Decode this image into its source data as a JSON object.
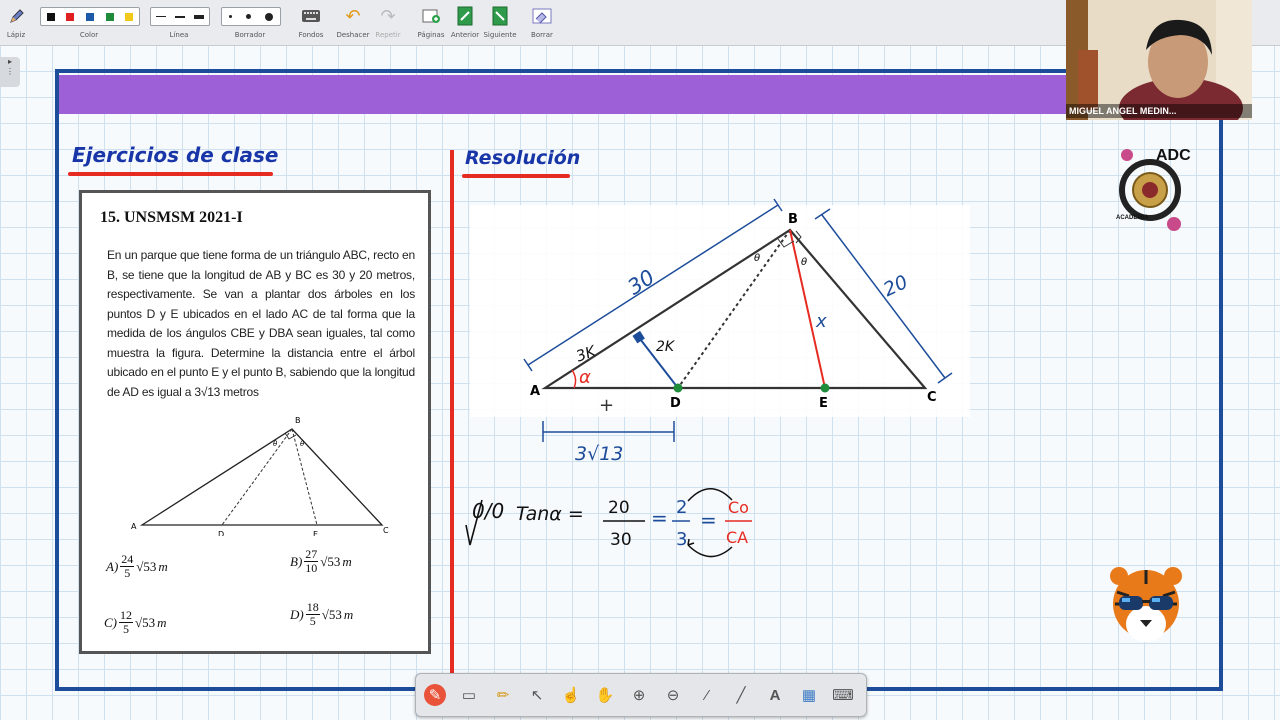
{
  "toolbar": {
    "items": [
      {
        "label": "Lápiz",
        "icon": "pencil-icon"
      },
      {
        "label": "Color"
      },
      {
        "label": "Línea"
      },
      {
        "label": "Borrador"
      },
      {
        "label": "Fondos",
        "icon": "keyboard-icon"
      },
      {
        "label": "Deshacer",
        "icon": "undo-icon"
      },
      {
        "label": "Repetir",
        "icon": "redo-icon"
      },
      {
        "label": "Páginas",
        "icon": "pages-icon"
      },
      {
        "label": "Anterior",
        "icon": "previous-page-icon"
      },
      {
        "label": "Siguiente",
        "icon": "next-page-icon"
      },
      {
        "label": "Borrar",
        "icon": "clear-icon"
      }
    ],
    "colors": [
      "#111111",
      "#e02020",
      "#1f5aa8",
      "#1e8c3a",
      "#f2c81a"
    ]
  },
  "webcam": {
    "name": "MIGUEL ANGEL MEDIN..."
  },
  "headings": {
    "left": "Ejercicios de clase",
    "right": "Resolución"
  },
  "problem": {
    "title": "15. UNSMSM 2021-I",
    "text": "En un parque que tiene forma de un triángulo ABC, recto en B, se tiene que la longitud de AB y BC es 30 y 20 metros, respectivamente. Se van a plantar dos árboles en los puntos D y E ubicados en el lado AC de tal forma que la medida de los ángulos CBE y DBA sean iguales, tal como muestra la figura. Determine la distancia entre el árbol ubicado en el punto E y el punto B, sabiendo que la longitud de AD es igual a 3",
    "text_root": "√13",
    "text_end": " metros",
    "figure_labels": {
      "A": "A",
      "B": "B",
      "C": "C",
      "D": "D",
      "E": "E",
      "theta": "θ"
    },
    "options": [
      {
        "letter": "A)",
        "num": "24",
        "den": "5",
        "root": "√53",
        "unit": "m"
      },
      {
        "letter": "B)",
        "num": "27",
        "den": "10",
        "root": "√53",
        "unit": "m"
      },
      {
        "letter": "C)",
        "num": "12",
        "den": "5",
        "root": "√53",
        "unit": "m"
      },
      {
        "letter": "D)",
        "num": "18",
        "den": "5",
        "root": "√53",
        "unit": "m"
      }
    ]
  },
  "solution": {
    "labels": {
      "A": "A",
      "B": "B",
      "C": "C",
      "D": "D",
      "E": "E",
      "theta": "θ",
      "alpha": "α"
    },
    "side_ab": "30",
    "side_bc": "20",
    "seg_3k": "3K",
    "seg_2k": "2K",
    "seg_x": "x",
    "ad_value": "3√13",
    "plus": "+",
    "check": "0/0",
    "equation": {
      "lhs": "Tanα =",
      "num1": "20",
      "den1": "30",
      "eq": "=",
      "num2": "2",
      "den2": "3",
      "eq2": "=",
      "num3": "Co",
      "den3": "CA"
    }
  },
  "logo": {
    "text": "ADC",
    "sub": "ACADEMIA"
  },
  "bottom_tools": [
    "pen-icon",
    "eraser-icon",
    "marker-icon",
    "pointer-icon",
    "hand-icon",
    "grab-icon",
    "zoom-in-icon",
    "zoom-out-icon",
    "brush-icon",
    "line-icon",
    "text-icon",
    "image-icon",
    "keyboard-icon"
  ],
  "bottom_tool_glyphs": [
    "✎",
    "▭",
    "✏",
    "↖",
    "☝",
    "✋",
    "⊕",
    "⊖",
    "⁄",
    "╱",
    "A",
    "▦",
    "⌨"
  ],
  "colors": {
    "banner": "#9d60d6",
    "board_border": "#1d4d9a",
    "red": "#e62b22",
    "heading": "#1836a8"
  }
}
